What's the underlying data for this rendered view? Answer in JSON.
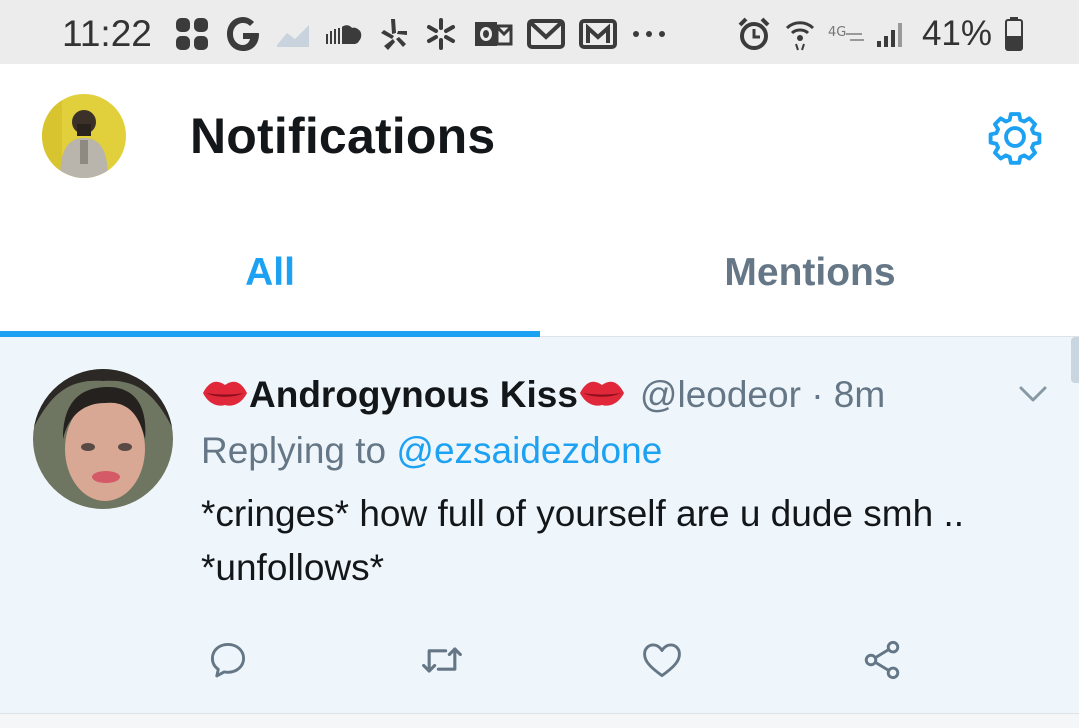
{
  "status_bar": {
    "time": "11:22",
    "battery_percent": "41%",
    "left_icons": [
      "dots-app-icon",
      "google-icon",
      "chart-icon",
      "soundcloud-icon",
      "yelp-icon",
      "walmart-icon",
      "outlook-icon",
      "gmail-icon",
      "gmail-icon",
      "more-icon"
    ],
    "right_icons": [
      "alarm-icon",
      "wifi-icon",
      "lte-icon",
      "signal-icon",
      "battery-icon"
    ]
  },
  "header": {
    "title": "Notifications",
    "settings_icon": "gear-icon",
    "accent_color": "#1da1f2"
  },
  "tabs": [
    {
      "label": "All",
      "active": true
    },
    {
      "label": "Mentions",
      "active": false
    }
  ],
  "tweet": {
    "display_name": "Androgynous Kiss",
    "handle_meta": "@leodeor · 8m",
    "replying_prefix": "Replying to ",
    "replying_to": "@ezsaidezdone",
    "text": "*cringes* how full of yourself are u dude smh .. *unfollows*",
    "actions": [
      "reply-icon",
      "retweet-icon",
      "like-icon",
      "share-icon"
    ]
  }
}
